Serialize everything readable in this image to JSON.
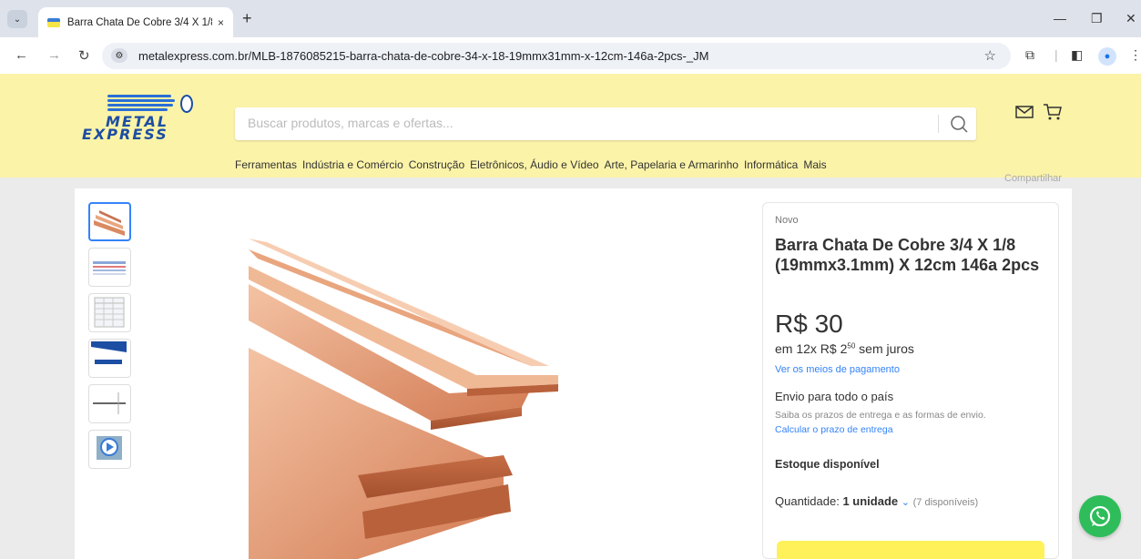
{
  "browser": {
    "tab_title": "Barra Chata De Cobre 3/4 X 1/8",
    "tab_close": "×",
    "new_tab": "+",
    "url": "metalexpress.com.br/MLB-1876085215-barra-chata-de-cobre-34-x-18-19mmx31mm-x-12cm-146a-2pcs-_JM"
  },
  "logo": {
    "line1": "METAL",
    "line2": "EXPRESS"
  },
  "search": {
    "placeholder": "Buscar produtos, marcas e ofertas..."
  },
  "categories": [
    "Ferramentas",
    "Indústria e Comércio",
    "Construção",
    "Eletrônicos, Áudio e Vídeo",
    "Arte, Papelaria e Armarinho",
    "Informática",
    "Mais"
  ],
  "product": {
    "condition": "Novo",
    "title": "Barra Chata De Cobre 3/4 X 1/8 (19mmx3.1mm) X 12cm 146a 2pcs",
    "price": "R$ 30",
    "installments_prefix": "em 12x R$ 2",
    "installments_cents": "50",
    "installments_suffix": " sem juros",
    "payment_link": "Ver os meios de pagamento",
    "shipping_title": "Envio para todo o país",
    "shipping_sub": "Saiba os prazos de entrega e as formas de envio.",
    "shipping_link": "Calcular o prazo de entrega",
    "stock": "Estoque disponível",
    "qty_label": "Quantidade: ",
    "qty_value": "1 unidade",
    "qty_available": "(7 disponíveis)"
  },
  "share": "Compartilhar",
  "colors": {
    "header_bg": "#fbf3a8",
    "accent": "#3483fa",
    "whatsapp": "#2ebd5a"
  }
}
